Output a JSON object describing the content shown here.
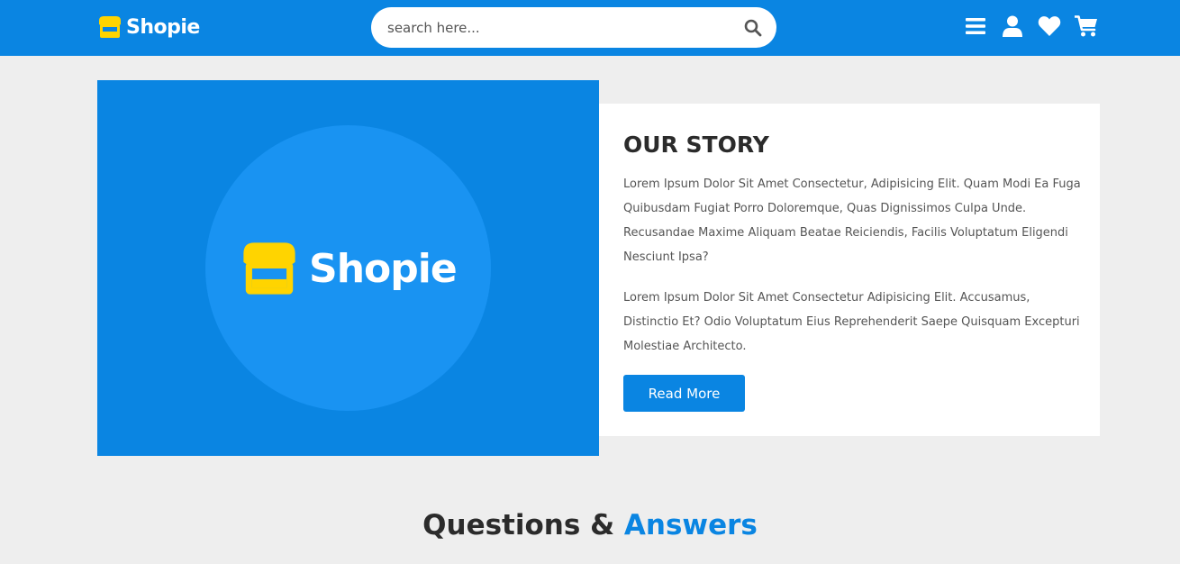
{
  "header": {
    "brand": "Shopie",
    "search_placeholder": "search here...",
    "icons": [
      "menu-icon",
      "user-icon",
      "heart-icon",
      "cart-icon"
    ]
  },
  "story": {
    "image_brand": "Shopie",
    "title": "OUR STORY",
    "paragraph1": "Lorem Ipsum Dolor Sit Amet Consectetur, Adipisicing Elit. Quam Modi Ea Fuga Quibusdam Fugiat Porro Doloremque, Quas Dignissimos Culpa Unde. Recusandae Maxime Aliquam Beatae Reiciendis, Facilis Voluptatum Eligendi Nesciunt Ipsa?",
    "paragraph2": "Lorem Ipsum Dolor Sit Amet Consectetur Adipisicing Elit. Accusamus, Distinctio Et? Odio Voluptatum Eius Reprehenderit Saepe Quisquam Excepturi Molestiae Architecto.",
    "button_label": "Read More"
  },
  "qa": {
    "heading_part1": "Questions & ",
    "heading_part2": "Answers"
  },
  "colors": {
    "primary": "#0a85e2",
    "logo_yellow": "#ffd400",
    "background": "#eeeeee",
    "text_dark": "#2b2b2b",
    "text_body": "#555555"
  }
}
